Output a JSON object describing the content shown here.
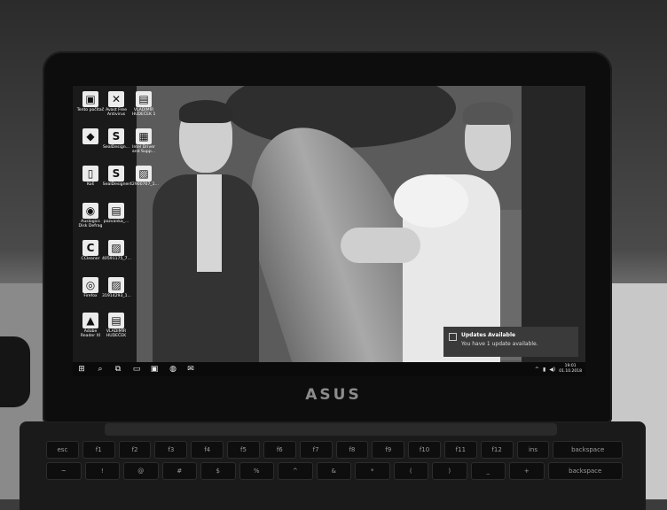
{
  "brand": "ASUS",
  "desktop": {
    "icons": [
      {
        "label": "Tento počítač",
        "glyph": "▣"
      },
      {
        "label": "Avast Free Antivirus",
        "glyph": "✕"
      },
      {
        "label": "VLADIMÍR HUDEČEK 1",
        "glyph": "▤"
      },
      {
        "label": "",
        "glyph": "◆"
      },
      {
        "label": "SealDesign...",
        "glyph": "S"
      },
      {
        "label": "Intel Driver and Supp...",
        "glyph": "▦"
      },
      {
        "label": "Koš",
        "glyph": "▯"
      },
      {
        "label": "SealDesigner",
        "glyph": "S"
      },
      {
        "label": "42900707_1...",
        "glyph": "▨"
      },
      {
        "label": "Auslogics Disk Defrag",
        "glyph": "◉"
      },
      {
        "label": "pozvanka_...",
        "glyph": "▤"
      },
      {
        "label": "CCleaner",
        "glyph": "C"
      },
      {
        "label": "40591175_7...",
        "glyph": "▨"
      },
      {
        "label": "Firefox",
        "glyph": "◎"
      },
      {
        "label": "31914293_1...",
        "glyph": "▨"
      },
      {
        "label": "Adobe Reader XI",
        "glyph": "▲"
      },
      {
        "label": "VLADIMÍR HUDEČEK",
        "glyph": "▤"
      }
    ]
  },
  "notification": {
    "title": "Updates Available",
    "text": "You have 1 update available."
  },
  "taskbar": {
    "start": "⊞",
    "search": "⌕",
    "task_view": "⧉",
    "apps": [
      "▭",
      "▣",
      "◍",
      "✉"
    ],
    "tray": [
      "^",
      "▮",
      "◀)"
    ],
    "time": "19:01",
    "date": "01.10.2018"
  },
  "keyboard": {
    "row1": [
      "esc",
      "f1",
      "f2",
      "f3",
      "f4",
      "f5",
      "f6",
      "f7",
      "f8",
      "f9",
      "f10",
      "f11",
      "f12",
      "ins",
      "backspace"
    ],
    "row2": [
      "~",
      "!",
      "@",
      "#",
      "$",
      "%",
      "^",
      "&",
      "*",
      "(",
      ")",
      "_",
      "+",
      "backspace"
    ]
  }
}
